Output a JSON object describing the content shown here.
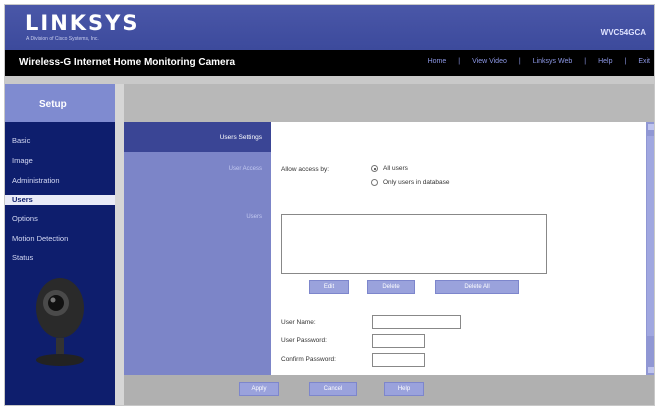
{
  "header": {
    "logo": "LINKSYS",
    "logo_tagline": "A Division of Cisco Systems, Inc.",
    "model": "WVC54GCA"
  },
  "navbar": {
    "product_title": "Wireless-G Internet Home Monitoring Camera",
    "links": [
      "Home",
      "View Video",
      "Linksys Web",
      "Help",
      "Exit"
    ]
  },
  "sidebar": {
    "title": "Setup",
    "items": [
      "Basic",
      "Image",
      "Administration",
      "Users",
      "Options",
      "Motion Detection",
      "Status"
    ],
    "active": "Users"
  },
  "section": {
    "title": "Users Settings",
    "row_access": "User Access",
    "row_users": "Users"
  },
  "form": {
    "access_label": "Allow access by:",
    "radio_all": "All users",
    "radio_db": "Only users in database",
    "selected_access": "All users",
    "list_buttons": [
      "Edit",
      "Delete",
      "Delete All"
    ],
    "username_label": "User Name:",
    "password_label": "User Password:",
    "confirm_label": "Confirm Password:"
  },
  "footer_buttons": [
    "Apply",
    "Cancel",
    "Help"
  ],
  "colors": {
    "header": "#3c4a9c",
    "sidebar": "#0e1e6d",
    "nav_link": "#8d98e6",
    "section": "#7c85c8",
    "button": "#9aa2dc"
  }
}
